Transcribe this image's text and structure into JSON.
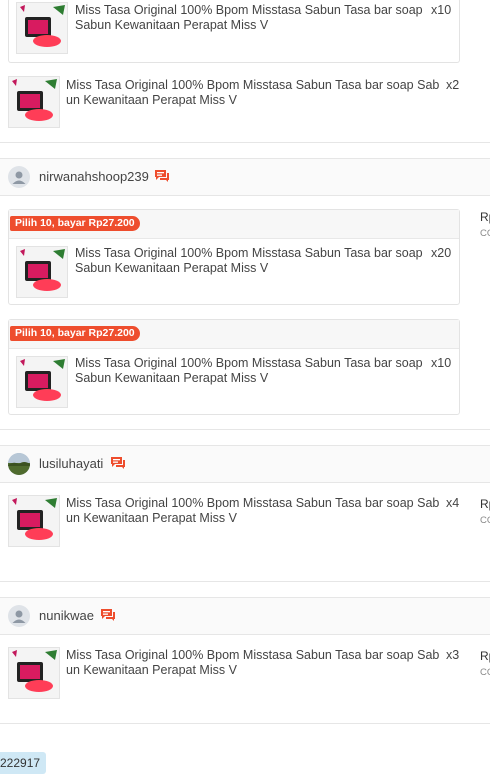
{
  "product_name_long": "Miss Tasa Original 100% Bpom Misstasa Sabun Tasa bar soap Sabun Kewanitaan Perapat Miss V",
  "product_name_short_lines": [
    "Miss Tasa Original 100% Bpom Misstasa Sabun Tasa bar soap Sab",
    "un Kewanitaan Perapat Miss V"
  ],
  "product_name_box_lines": [
    "Miss Tasa Original 100% Bpom Misstasa Sabun Tasa bar soap",
    "Sabun Kewanitaan Perapat Miss V"
  ],
  "top_items": [
    {
      "qty": "x10"
    },
    {
      "qty": "x2"
    }
  ],
  "orders": [
    {
      "username": "nirwanahshoop239",
      "price_partial": "Rp",
      "price_sub": "CO",
      "groups": [
        {
          "promo": "Pilih 10, bayar Rp27.200",
          "qty": "x20"
        },
        {
          "promo": "Pilih 10, bayar Rp27.200",
          "qty": "x10"
        }
      ]
    },
    {
      "username": "lusiluhayati",
      "price_partial": "Rp",
      "price_sub": "CO",
      "item_qty": "x4"
    },
    {
      "username": "nunikwae",
      "price_partial": "Rp",
      "price_sub": "CO",
      "item_qty": "x3"
    }
  ],
  "footer": {
    "order_id": "222917"
  },
  "colors": {
    "accent": "#ee4d2d",
    "badge_bg": "#cfe8f5"
  }
}
